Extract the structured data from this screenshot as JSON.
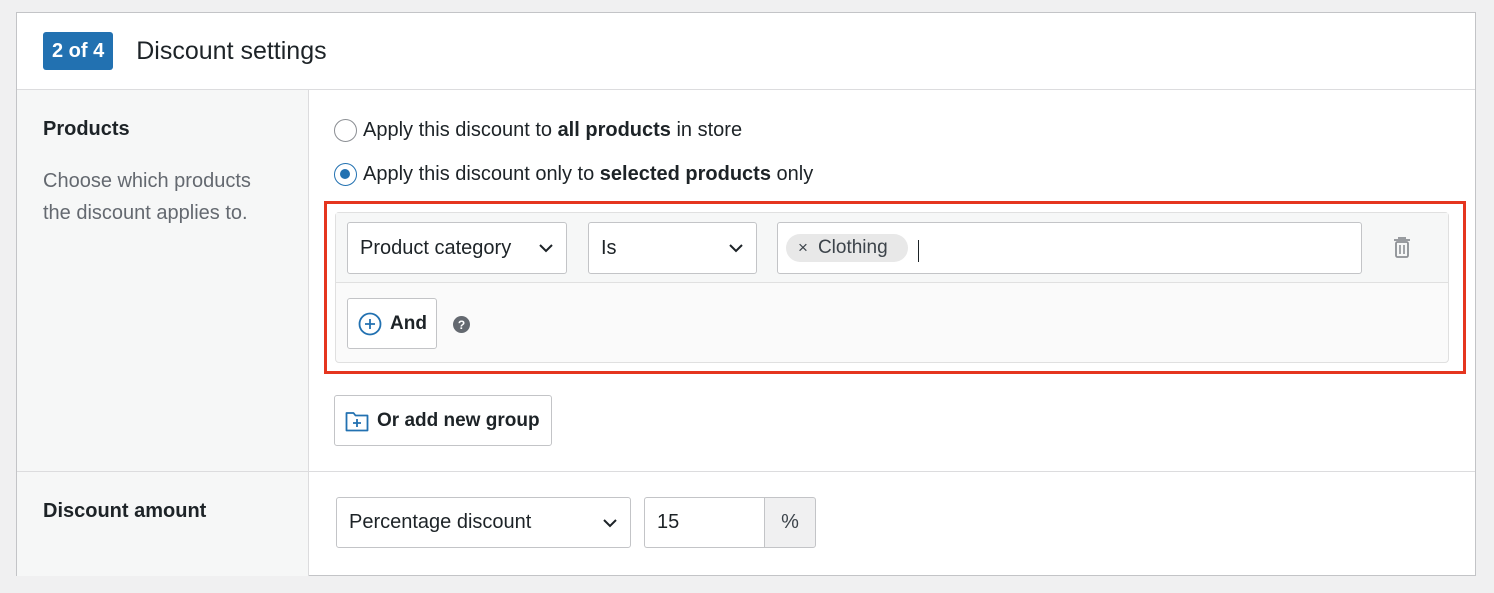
{
  "header": {
    "step_badge": "2 of 4",
    "title": "Discount settings"
  },
  "products": {
    "label": "Products",
    "description": "Choose which products the discount applies to.",
    "option_all": {
      "prefix": "Apply this discount to ",
      "bold": "all products",
      "suffix": " in store",
      "checked": false
    },
    "option_selected": {
      "prefix": "Apply this discount only to ",
      "bold": "selected products",
      "suffix": " only",
      "checked": true
    },
    "condition": {
      "field": "Product category",
      "operator": "Is",
      "values": [
        "Clothing"
      ],
      "tag_remove": "×"
    },
    "and_button": "And",
    "or_group_button": "Or add new group"
  },
  "amount": {
    "label": "Discount amount",
    "type": "Percentage discount",
    "value": "15",
    "unit": "%"
  },
  "colors": {
    "accent": "#2271b1",
    "highlight": "#e5351f"
  },
  "icons": {
    "chevron": "chevron-down-icon",
    "trash": "trash-icon",
    "plus_circle": "plus-circle-icon",
    "help": "help-icon",
    "folder_plus": "folder-plus-icon"
  }
}
